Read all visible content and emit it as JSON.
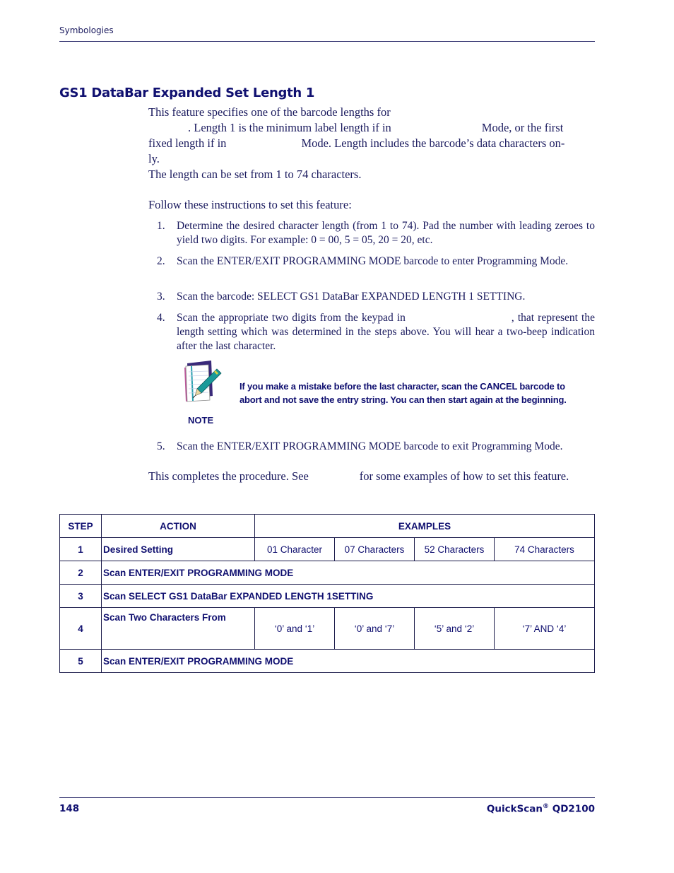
{
  "header": {
    "section": "Symbologies"
  },
  "title": "GS1 DataBar Expanded Set Length 1",
  "intro": {
    "line1": "This feature specifies one of the barcode lengths for",
    "line2a": ". Length 1 is the minimum label length if in",
    "line2b": "Mode, or the first",
    "line3a": "fixed length if in",
    "line3b": "Mode. Length includes the barcode’s data characters on-",
    "line4": "ly.",
    "range": "The length can be set from 1 to 74 characters.",
    "follow": "Follow these instructions to set this feature:"
  },
  "steps": [
    {
      "num": "1.",
      "text": "Determine the desired character length (from 1 to 74). Pad the number with leading zeroes to yield two digits. For example: 0 = 00, 5 = 05, 20 = 20, etc."
    },
    {
      "num": "2.",
      "text": "Scan the ENTER/EXIT PROGRAMMING MODE barcode to enter Programming Mode."
    },
    {
      "num": "3.",
      "text": "Scan the barcode: SELECT GS1 DataBar EXPANDED LENGTH 1 SETTING."
    },
    {
      "num": "4.",
      "text_a": "Scan the appropriate two digits from the keypad in",
      "text_b": ", that represent the length setting which was determined in the steps above. You will hear a two-beep indication after the last character."
    },
    {
      "num": "5.",
      "text": "Scan the ENTER/EXIT PROGRAMMING MODE barcode to exit Programming Mode."
    }
  ],
  "note": {
    "icon": "note-pad-pen-icon",
    "label": "NOTE",
    "text": "If you make a mistake before the last character, scan the CANCEL barcode to abort and not save the entry string. You can then start again at the beginning."
  },
  "completes": {
    "before": "This completes the procedure. See",
    "after": "for some examples of how to set this feature."
  },
  "table": {
    "headers": {
      "step": "STEP",
      "action": "ACTION",
      "examples": "EXAMPLES"
    },
    "rows": [
      {
        "step": "1",
        "action": "Desired Setting",
        "examples": [
          "01 Character",
          "07 Characters",
          "52 Characters",
          "74 Characters"
        ]
      },
      {
        "step": "2",
        "action": "Scan ENTER/EXIT PROGRAMMING MODE"
      },
      {
        "step": "3",
        "action": "Scan SELECT GS1 DataBar EXPANDED LENGTH 1SETTING"
      },
      {
        "step": "4",
        "action": "Scan Two Characters From",
        "examples": [
          "‘0’ and ‘1’",
          "‘0’ and ‘7’",
          "‘5’ and ‘2’",
          "‘7’ AND ‘4’"
        ]
      },
      {
        "step": "5",
        "action": "Scan ENTER/EXIT PROGRAMMING MODE"
      }
    ]
  },
  "footer": {
    "page_number": "148",
    "product": "QuickScan",
    "registered": "®",
    "model": " QD2100"
  }
}
